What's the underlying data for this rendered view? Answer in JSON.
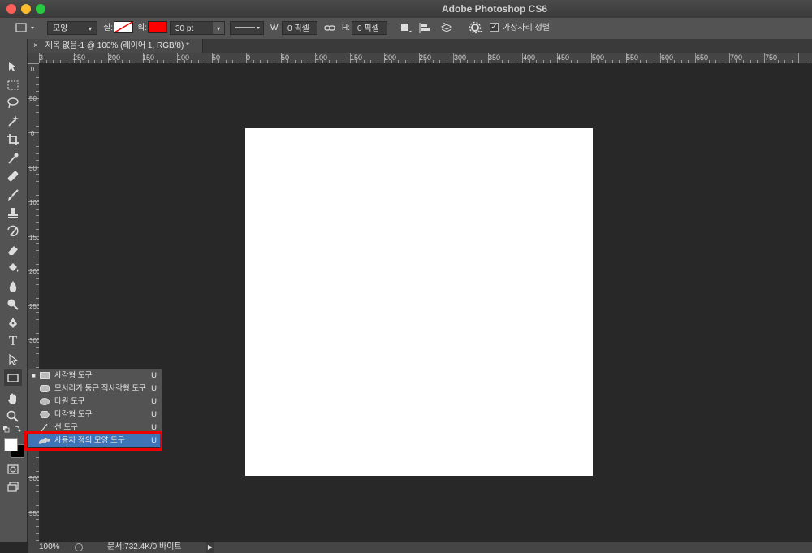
{
  "window": {
    "title": "Adobe Photoshop CS6"
  },
  "options_bar": {
    "mode": "모양",
    "fill_label": "칠:",
    "stroke_label": "획:",
    "stroke_color": "#ff0000",
    "stroke_width": "30 pt",
    "w_label": "W:",
    "w_value": "0 픽셀",
    "h_label": "H:",
    "h_value": "0 픽셀",
    "align_edges_label": "가장자리 정렬",
    "align_edges_checked": true
  },
  "document": {
    "tab_title": "제목 없음-1 @ 100% (레이어 1, RGB/8) *",
    "close_glyph": "×"
  },
  "ruler": {
    "top_labels": [
      "3",
      "250",
      "200",
      "150",
      "100",
      "50",
      "0",
      "50",
      "100",
      "150",
      "200",
      "250",
      "300",
      "350",
      "400",
      "450",
      "500",
      "550",
      "600",
      "650",
      "700",
      "750"
    ],
    "left_labels": [
      "0",
      "50",
      "0",
      "50",
      "100",
      "150",
      "200",
      "250",
      "300",
      "350",
      "400",
      "450",
      "500",
      "550"
    ]
  },
  "flyout": {
    "items": [
      {
        "label": "사각형 도구",
        "key": "U",
        "icon": "rectangle-icon",
        "active": true
      },
      {
        "label": "모서리가 둥근 직사각형 도구",
        "key": "U",
        "icon": "rounded-rectangle-icon"
      },
      {
        "label": "타원 도구",
        "key": "U",
        "icon": "ellipse-icon"
      },
      {
        "label": "다각형 도구",
        "key": "U",
        "icon": "polygon-icon"
      },
      {
        "label": "선 도구",
        "key": "U",
        "icon": "line-icon"
      },
      {
        "label": "사용자 정의 모양 도구",
        "key": "U",
        "icon": "custom-shape-icon",
        "selected": true
      }
    ]
  },
  "status": {
    "zoom": "100%",
    "doc_info": "문서:732.4K/0 바이트"
  }
}
